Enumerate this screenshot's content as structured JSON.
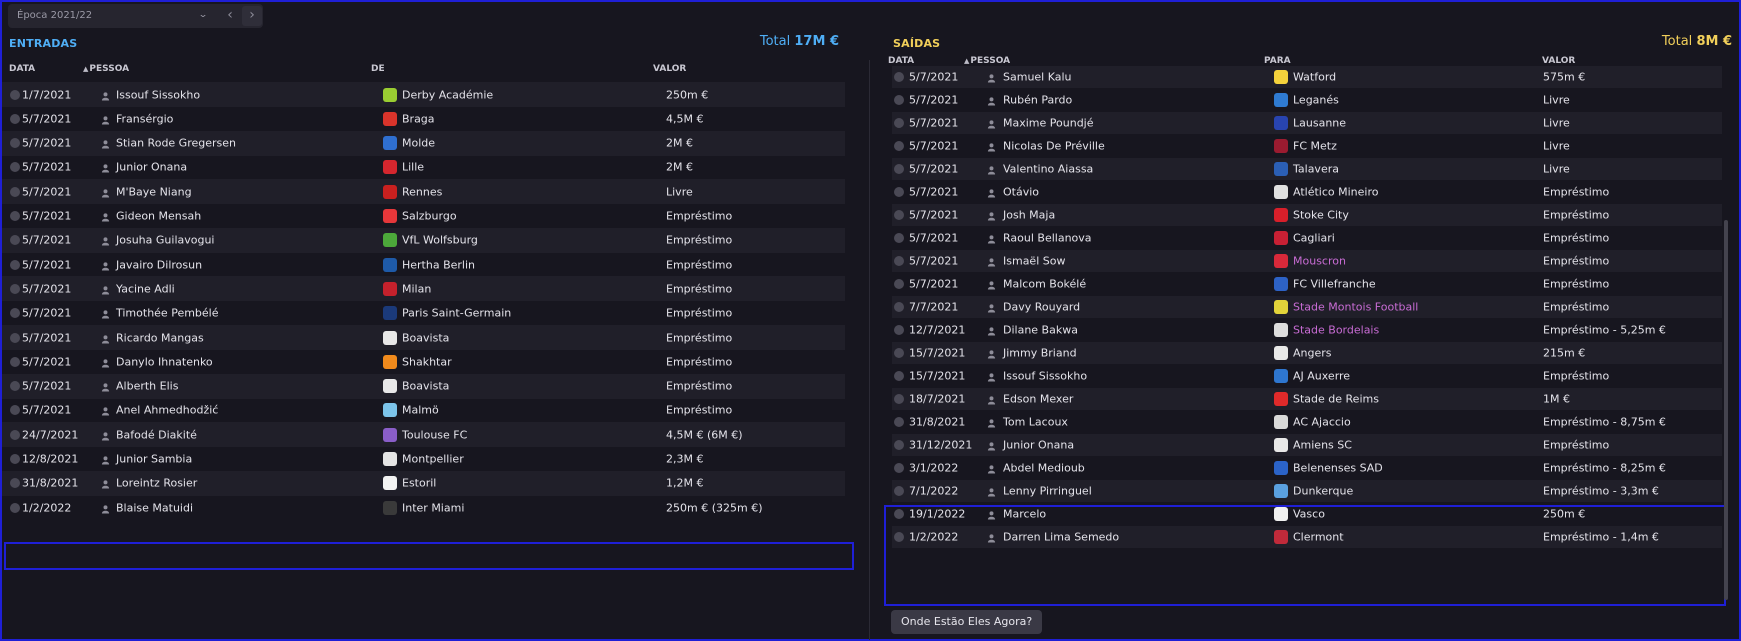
{
  "topbar": {
    "season": "Época 2021/22",
    "chevron": "⌄",
    "prev": "‹",
    "next": "›"
  },
  "left": {
    "title": "ENTRADAS",
    "total_label": "Total",
    "total_value": "17M €",
    "headers": {
      "date": "DATA",
      "person": "PESSOA",
      "club": "DE",
      "value": "VALOR"
    },
    "rows": [
      {
        "date": "1/7/2021",
        "person": "Issouf Sissokho",
        "club": "Derby Académie",
        "value": "250m €",
        "crest": "#9acd32",
        "link": false
      },
      {
        "date": "5/7/2021",
        "person": "Fransérgio",
        "club": "Braga",
        "value": "4,5M €",
        "crest": "#d9342b",
        "link": false
      },
      {
        "date": "5/7/2021",
        "person": "Stian Rode Gregersen",
        "club": "Molde",
        "value": "2M €",
        "crest": "#2f6fd0",
        "link": false
      },
      {
        "date": "5/7/2021",
        "person": "Junior Onana",
        "club": "Lille",
        "value": "2M €",
        "crest": "#d4262e",
        "link": false
      },
      {
        "date": "5/7/2021",
        "person": "M'Baye Niang",
        "club": "Rennes",
        "value": "Livre",
        "crest": "#c8201f",
        "link": false
      },
      {
        "date": "5/7/2021",
        "person": "Gideon Mensah",
        "club": "Salzburgo",
        "value": "Empréstimo",
        "crest": "#e6373a",
        "link": false
      },
      {
        "date": "5/7/2021",
        "person": "Josuha Guilavogui",
        "club": "VfL Wolfsburg",
        "value": "Empréstimo",
        "crest": "#4ca83a",
        "link": false
      },
      {
        "date": "5/7/2021",
        "person": "Javairo Dilrosun",
        "club": "Hertha Berlin",
        "value": "Empréstimo",
        "crest": "#1e5aa8",
        "link": false
      },
      {
        "date": "5/7/2021",
        "person": "Yacine Adli",
        "club": "Milan",
        "value": "Empréstimo",
        "crest": "#c4212c",
        "link": false
      },
      {
        "date": "5/7/2021",
        "person": "Timothée Pembélé",
        "club": "Paris Saint-Germain",
        "value": "Empréstimo",
        "crest": "#1b3a7a",
        "link": false
      },
      {
        "date": "5/7/2021",
        "person": "Ricardo Mangas",
        "club": "Boavista",
        "value": "Empréstimo",
        "crest": "#e8e8e8",
        "link": false
      },
      {
        "date": "5/7/2021",
        "person": "Danylo Ihnatenko",
        "club": "Shakhtar",
        "value": "Empréstimo",
        "crest": "#f08a1c",
        "link": false
      },
      {
        "date": "5/7/2021",
        "person": "Alberth Elis",
        "club": "Boavista",
        "value": "Empréstimo",
        "crest": "#e8e8e8",
        "link": false
      },
      {
        "date": "5/7/2021",
        "person": "Anel Ahmedhodžić",
        "club": "Malmö",
        "value": "Empréstimo",
        "crest": "#7cc4ea",
        "link": false
      },
      {
        "date": "24/7/2021",
        "person": "Bafodé Diakité",
        "club": "Toulouse FC",
        "value": "4,5M € (6M €)",
        "crest": "#8a5ec9",
        "link": false
      },
      {
        "date": "12/8/2021",
        "person": "Junior Sambia",
        "club": "Montpellier",
        "value": "2,3M €",
        "crest": "#e4e4e4",
        "link": false
      },
      {
        "date": "31/8/2021",
        "person": "Loreintz Rosier",
        "club": "Estoril",
        "value": "1,2M €",
        "crest": "#f2f2f2",
        "link": false
      },
      {
        "date": "1/2/2022",
        "person": "Blaise Matuidi",
        "club": "Inter Miami",
        "value": "250m € (325m €)",
        "crest": "#3a3a3a",
        "link": false
      }
    ]
  },
  "right": {
    "title": "SAÍDAS",
    "total_label": "Total",
    "total_value": "8M €",
    "headers": {
      "date": "DATA",
      "person": "PESSOA",
      "club": "PARA",
      "value": "VALOR"
    },
    "rows": [
      {
        "date": "5/7/2021",
        "person": "Samuel Kalu",
        "club": "Watford",
        "value": "575m €",
        "crest": "#f4d23c",
        "link": false
      },
      {
        "date": "5/7/2021",
        "person": "Rubén Pardo",
        "club": "Leganés",
        "value": "Livre",
        "crest": "#2f7bd2",
        "link": false
      },
      {
        "date": "5/7/2021",
        "person": "Maxime Poundjé",
        "club": "Lausanne",
        "value": "Livre",
        "crest": "#2844b0",
        "link": false
      },
      {
        "date": "5/7/2021",
        "person": "Nicolas De Préville",
        "club": "FC Metz",
        "value": "Livre",
        "crest": "#9b1b30",
        "link": false
      },
      {
        "date": "5/7/2021",
        "person": "Valentino Aiassa",
        "club": "Talavera",
        "value": "Livre",
        "crest": "#2b5fb5",
        "link": false
      },
      {
        "date": "5/7/2021",
        "person": "Otávio",
        "club": "Atlético Mineiro",
        "value": "Empréstimo",
        "crest": "#e0e0e0",
        "link": false
      },
      {
        "date": "5/7/2021",
        "person": "Josh Maja",
        "club": "Stoke City",
        "value": "Empréstimo",
        "crest": "#d81f2a",
        "link": false
      },
      {
        "date": "5/7/2021",
        "person": "Raoul Bellanova",
        "club": "Cagliari",
        "value": "Empréstimo",
        "crest": "#c82034",
        "link": false
      },
      {
        "date": "5/7/2021",
        "person": "Ismaël Sow",
        "club": "Mouscron",
        "value": "Empréstimo",
        "crest": "#d9293a",
        "link": true
      },
      {
        "date": "5/7/2021",
        "person": "Malcom Bokélé",
        "club": "FC Villefranche",
        "value": "Empréstimo",
        "crest": "#2d62c6",
        "link": false
      },
      {
        "date": "7/7/2021",
        "person": "Davy Rouyard",
        "club": "Stade Montois Football",
        "value": "Empréstimo",
        "crest": "#e2d33a",
        "link": true
      },
      {
        "date": "12/7/2021",
        "person": "Dilane Bakwa",
        "club": "Stade Bordelais",
        "value": "Empréstimo - 5,25m €",
        "crest": "#dddddd",
        "link": true
      },
      {
        "date": "15/7/2021",
        "person": "Jimmy Briand",
        "club": "Angers",
        "value": "215m €",
        "crest": "#e8e8e8",
        "link": false
      },
      {
        "date": "15/7/2021",
        "person": "Issouf Sissokho",
        "club": "AJ Auxerre",
        "value": "Empréstimo",
        "crest": "#2e76cf",
        "link": false
      },
      {
        "date": "18/7/2021",
        "person": "Edson Mexer",
        "club": "Stade de Reims",
        "value": "1M €",
        "crest": "#e02a2a",
        "link": false
      },
      {
        "date": "31/8/2021",
        "person": "Tom Lacoux",
        "club": "AC Ajaccio",
        "value": "Empréstimo - 8,75m €",
        "crest": "#d9d9d9",
        "link": false
      },
      {
        "date": "31/12/2021",
        "person": "Junior Onana",
        "club": "Amiens SC",
        "value": "Empréstimo",
        "crest": "#e8e8e8",
        "link": false
      },
      {
        "date": "3/1/2022",
        "person": "Abdel Medioub",
        "club": "Belenenses SAD",
        "value": "Empréstimo - 8,25m €",
        "crest": "#2b63c8",
        "link": false
      },
      {
        "date": "7/1/2022",
        "person": "Lenny Pirringuel",
        "club": "Dunkerque",
        "value": "Empréstimo - 3,3m €",
        "crest": "#5aa0e0",
        "link": false
      },
      {
        "date": "19/1/2022",
        "person": "Marcelo",
        "club": "Vasco",
        "value": "250m €",
        "crest": "#f0f0f0",
        "link": false
      },
      {
        "date": "1/2/2022",
        "person": "Darren Lima Semedo",
        "club": "Clermont",
        "value": "Empréstimo - 1,4m €",
        "crest": "#c02a3a",
        "link": false
      }
    ]
  },
  "footer": {
    "button_label": "Onde Estão Eles Agora?"
  }
}
